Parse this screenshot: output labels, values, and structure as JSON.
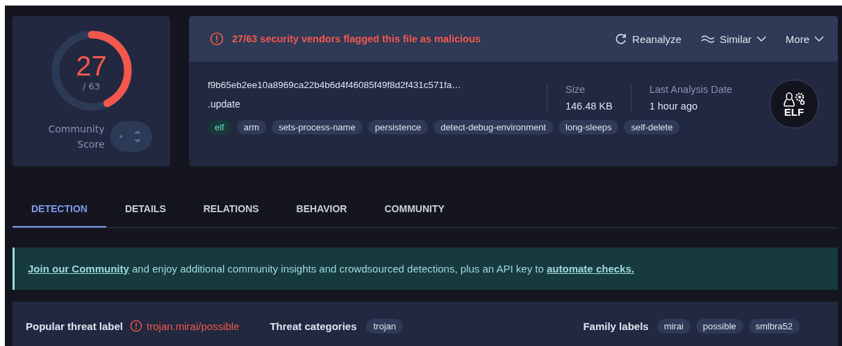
{
  "score": {
    "detections": "27",
    "total": "/ 63",
    "level": 0.4286,
    "community_label": "Community Score"
  },
  "alert": {
    "text": "27/63 security vendors flagged this file as malicious"
  },
  "actions": [
    {
      "label": "Reanalyze",
      "kind": "reload"
    },
    {
      "label": "Similar",
      "kind": "similar"
    },
    {
      "label": "More",
      "kind": "more"
    }
  ],
  "file": {
    "hash": "f9b65eb2ee10a8969ca22b4b6d4f46085f49f8d2f431c571fa…",
    "name": ".update",
    "stats": [
      {
        "label": "Size",
        "value": "146.48 KB"
      },
      {
        "label": "Last Analysis Date",
        "value": "1 hour ago"
      }
    ],
    "type_label": "ELF",
    "tags": [
      {
        "text": "elf",
        "kind": "filetype"
      },
      {
        "text": "arm",
        "kind": "tag"
      },
      {
        "text": "sets-process-name",
        "kind": "tag"
      },
      {
        "text": "persistence",
        "kind": "tag"
      },
      {
        "text": "detect-debug-environment",
        "kind": "tag"
      },
      {
        "text": "long-sleeps",
        "kind": "tag"
      },
      {
        "text": "self-delete",
        "kind": "tag"
      }
    ]
  },
  "tabs": [
    {
      "label": "DETECTION",
      "selected": true
    },
    {
      "label": "DETAILS",
      "selected": false
    },
    {
      "label": "RELATIONS",
      "selected": false
    },
    {
      "label": "BEHAVIOR",
      "selected": false
    },
    {
      "label": "COMMUNITY",
      "selected": false
    }
  ],
  "banner": [
    {
      "kind": "link",
      "text": "Join our Community"
    },
    {
      "kind": "text",
      "text": " and enjoy additional community insights and crowdsourced detections, plus an API key to "
    },
    {
      "kind": "link",
      "text": "automate checks."
    }
  ],
  "summary": {
    "threat_label_title": "Popular threat label",
    "threat_label": "trojan.mirai/possible",
    "categories_title": "Threat categories",
    "categories": [
      "trojan"
    ],
    "family_title": "Family labels",
    "families": [
      "mirai",
      "possible",
      "smlbra52"
    ]
  }
}
